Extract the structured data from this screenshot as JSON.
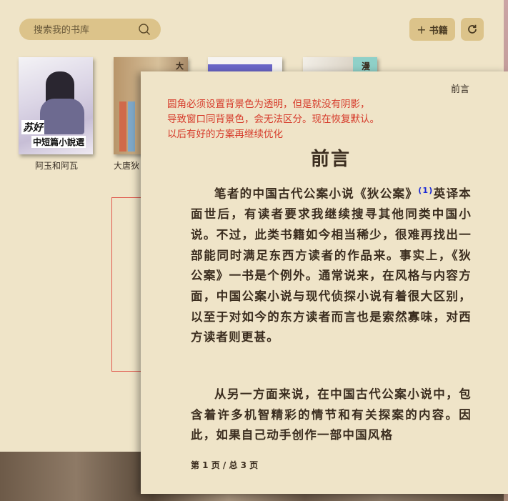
{
  "library": {
    "search": {
      "placeholder": "搜索我的书库",
      "value": ""
    },
    "add_books_label": "书籍",
    "books": [
      {
        "title": "阿玉和阿瓦",
        "cover_text": [
          "苏好",
          "中短篇小說選"
        ]
      },
      {
        "title": "大唐狄",
        "cover_text": [
          "大"
        ]
      },
      {
        "title": "",
        "cover_text": []
      },
      {
        "title": "",
        "cover_text": [
          "漫"
        ]
      }
    ]
  },
  "reader": {
    "header_title": "前言",
    "notes": [
      "圆角必须设置背景色为透明，但是就没有阴影，",
      "导致窗口同背景色，会无法区分。现在恢复默认。",
      "以后有好的方案再继续优化"
    ],
    "chapter_title": "前言",
    "para1_before_fn": "笔者的中国古代公案小说《狄公案》",
    "para1_footnote": "(1)",
    "para1_after_fn": "英译本面世后，有读者要求我继续搜寻其他同类中国小说。不过，此类书籍如今相当稀少，很难再找出一部能同时满足东西方读者的作品来。事实上，《狄公案》一书是个例外。通常说来，在风格与内容方面，中国公案小说与现代侦探小说有着很大区别，以至于对如今的东方读者而言也是索然寡味，对西方读者则更甚。",
    "para2": "从另一方面来说，在中国古代公案小说中，包含着许多机智精彩的情节和有关探案的内容。因此，如果自己动手创作一部中国风格",
    "page_info": "第 1 页 / 总 3 页"
  },
  "colors": {
    "background": "#efe4c8",
    "button": "#dcc38a",
    "note_red": "#d63a2a",
    "annotation_arrow": "#e83cf0",
    "annotation_box": "#e0584c",
    "footnote_blue": "#1b2ad6"
  },
  "icons": {
    "search": "search-icon",
    "add": "plus-icon",
    "refresh": "refresh-icon"
  }
}
